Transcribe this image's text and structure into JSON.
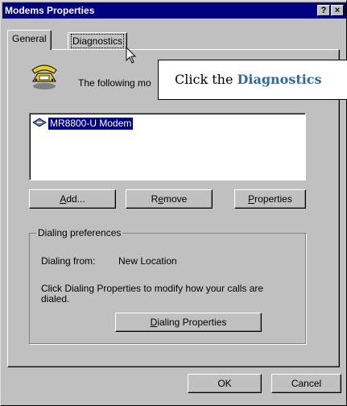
{
  "window": {
    "title": "Modems Properties"
  },
  "title_buttons": {
    "help": "?",
    "close": "×"
  },
  "tabs": [
    {
      "label": "General",
      "active": true
    },
    {
      "label": "Diagnostics",
      "active": false
    }
  ],
  "general": {
    "intro_text": "The following mo",
    "modems": [
      {
        "name": "MR8800-U Modem",
        "selected": true
      }
    ],
    "buttons": {
      "add_pre": "",
      "add_u": "A",
      "add_post": "dd...",
      "remove_pre": "R",
      "remove_u": "e",
      "remove_post": "move",
      "properties_pre": "",
      "properties_u": "P",
      "properties_post": "roperties"
    },
    "dialing_preferences": {
      "label": "Dialing preferences",
      "from_label": "Dialing from:",
      "from_value": "New Location",
      "hint_line1": "Click Dialing Properties to modify how your calls are",
      "hint_line2": "dialed.",
      "button_u": "D",
      "button_post": "ialing Properties"
    }
  },
  "footer": {
    "ok": "OK",
    "cancel": "Cancel"
  },
  "tooltip": {
    "prefix": "Click the ",
    "highlight": "Diagnostics"
  }
}
